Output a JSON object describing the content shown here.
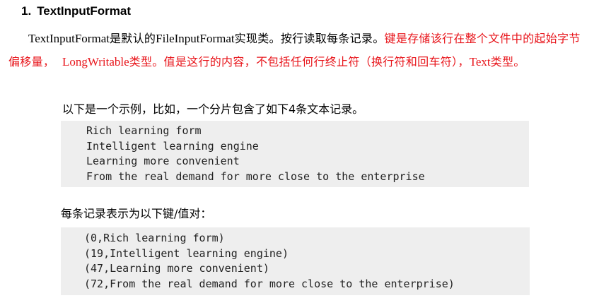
{
  "heading": {
    "number": "1.",
    "title": "TextInputFormat"
  },
  "paragraph": {
    "p1_name": "TextInputFormat",
    "p1_t1": "是默认的",
    "p1_name2": "FileInputFormat",
    "p1_t2": "实现类。按行读取每条记录。",
    "p1_red1": "键是存储该行在整个文件中的起始字节偏移量，",
    "p1_red_type1": "LongWritable",
    "p1_red2": "类型。值是这行的内容，不包括任何行终止符（换行符和回车符），",
    "p1_red_type2": "Text",
    "p1_red3": "类型。"
  },
  "intro": "以下是一个示例，比如，一个分片包含了如下4条文本记录。",
  "records": [
    "Rich learning form",
    "Intelligent learning engine",
    "Learning more convenient",
    "From the real demand for more close to the enterprise"
  ],
  "kv_label": "每条记录表示为以下键/值对：",
  "kv_pairs": [
    "(0,Rich learning form)",
    "(19,Intelligent learning engine)",
    "(47,Learning more convenient)",
    "(72,From the real demand for more close to the enterprise)"
  ]
}
